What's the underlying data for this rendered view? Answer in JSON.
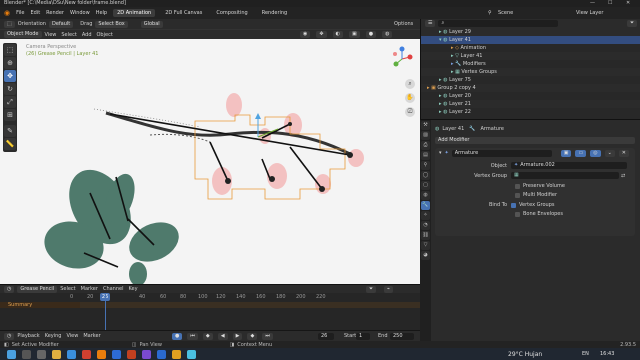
{
  "window": {
    "title": "Blender* [C:\\Media\\DSu\\New folder\\frame.blend]",
    "controls": [
      "—",
      "☐",
      "✕"
    ]
  },
  "menu": {
    "items": [
      "File",
      "Edit",
      "Render",
      "Window",
      "Help"
    ],
    "workspaces": [
      "2D Animation",
      "2D Full Canvas",
      "Compositing",
      "Rendering"
    ],
    "active_workspace": "2D Animation",
    "scene_label": "Scene",
    "view_layer_label": "View Layer"
  },
  "viewport_header": {
    "orientation_label": "Orientation",
    "orientation_value": "Default",
    "drag_label": "Drag",
    "drag_value": "Select Box",
    "transform_label": "Global",
    "options_label": "Options"
  },
  "viewport_header2": {
    "mode": "Object Mode",
    "menus": [
      "View",
      "Select",
      "Add",
      "Object"
    ]
  },
  "viewport": {
    "overlay_line1": "Camera Perspective",
    "overlay_line2": "(26) Grease Pencil | Layer 41"
  },
  "timeline": {
    "editor": "Grease Pencil",
    "menus": [
      "Select",
      "Marker",
      "Channel",
      "Key"
    ],
    "current_frame": "26",
    "ruler": [
      "0",
      "20",
      "40",
      "60",
      "80",
      "100",
      "120",
      "140",
      "160",
      "180",
      "200",
      "220"
    ],
    "summary_label": "Summary"
  },
  "playback": {
    "menus": [
      "Playback",
      "Keying",
      "View",
      "Marker"
    ],
    "frame": "26",
    "start_label": "Start",
    "start_value": "1",
    "end_label": "End",
    "end_value": "250"
  },
  "statusbar": {
    "left": "Set Active Modifier",
    "middle": "Pan View",
    "right": "Context Menu",
    "version": "2.93.5"
  },
  "outliner": {
    "rows": [
      {
        "label": "Layer 29",
        "indent": 1
      },
      {
        "label": "Layer 41",
        "indent": 1,
        "selected": true
      },
      {
        "label": "Animation",
        "indent": 2
      },
      {
        "label": "Layer 41",
        "indent": 2
      },
      {
        "label": "Modifiers",
        "indent": 2
      },
      {
        "label": "Vertex Groups",
        "indent": 2
      },
      {
        "label": "Layer 75",
        "indent": 1
      },
      {
        "label": "Group 2 copy 4",
        "indent": 0
      },
      {
        "label": "Layer 20",
        "indent": 1
      },
      {
        "label": "Layer 21",
        "indent": 1
      },
      {
        "label": "Layer 22",
        "indent": 1
      }
    ]
  },
  "properties": {
    "breadcrumb_obj": "Layer 41",
    "breadcrumb_mod": "Armature",
    "add_modifier": "Add Modifier",
    "modifier_name": "Armature",
    "object_label": "Object",
    "object_value": "Armature.002",
    "vertex_group_label": "Vertex Group",
    "preserve_volume": "Preserve Volume",
    "multi_modifier": "Multi Modifier",
    "bind_to_label": "Bind To",
    "vertex_groups": "Vertex Groups",
    "bone_envelopes": "Bone Envelopes"
  },
  "taskbar": {
    "weather": "29°C Hujan",
    "lang": "EN",
    "time": "16:43"
  },
  "colors": {
    "accent": "#4772b3",
    "selection": "#334d80",
    "playhead": "#4772b3",
    "summary": "#e08a1e"
  }
}
